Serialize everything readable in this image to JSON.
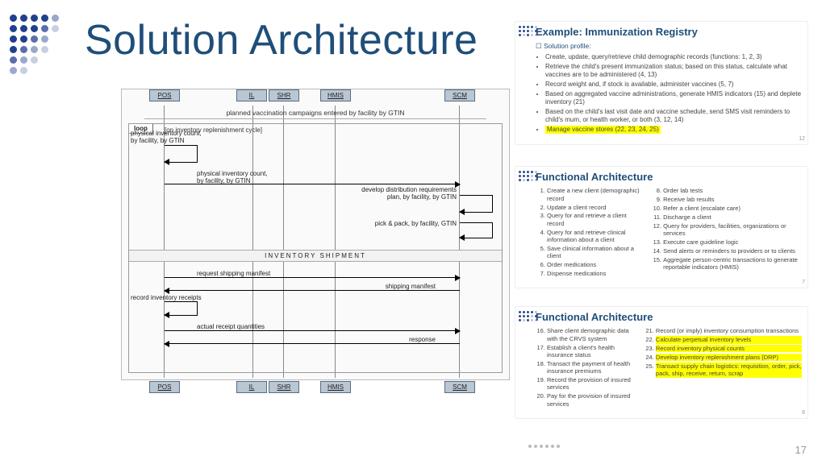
{
  "title": "Solution Architecture",
  "page_number": "17",
  "diagram": {
    "actors": [
      "POS",
      "IL",
      "SHR",
      "HMIS",
      "SCM"
    ],
    "caption": "planned vaccination campaigns entered by facility by GTIN",
    "loop_label": "loop",
    "loop_guard": "[on inventory replenishment cycle]",
    "self_msgs": {
      "pos_count": "physical inventory count,\nby facility, by GTIN",
      "scm_plan": "develop distribution requirements\nplan, by facility, by GTIN",
      "scm_pick": "pick & pack, by facility, GTIN"
    },
    "msgs": {
      "count_fwd": "physical inventory count,\nby facility, by GTIN",
      "req_manifest": "request shipping manifest",
      "ship_manifest": "shipping manifest",
      "record_receipts": "record inventory receipts",
      "actual_qty": "actual receipt quantities",
      "response": "response"
    },
    "block": "INVENTORY SHIPMENT"
  },
  "thumbs": {
    "imm": {
      "title": "Example: Immunization Registry",
      "subtitle": "Solution profile:",
      "bullets": [
        "Create, update, query/retrieve child demographic records (functions: 1, 2, 3)",
        "Retrieve the child's present immunization status; based on this status, calculate what vaccines are to be administered (4, 13)",
        "Record weight and, if stock is available, administer vaccines (5, 7)",
        "Based on aggregated vaccine administrations, generate HMIS indicators (15) and deplete inventory (21)",
        "Based on the child's last visit date and vaccine schedule, send SMS visit reminders to child's mum, or health worker, or both (3, 12, 14)"
      ],
      "highlight": "Manage vaccine stores (22, 23, 24, 25)",
      "pg": "12"
    },
    "fa1": {
      "title": "Functional Architecture",
      "left": [
        "Create a new client (demographic) record",
        "Update a client record",
        "Query for and retrieve a client record",
        "Query for and retrieve clinical information about a client",
        "Save clinical information about a client",
        "Order medications",
        "Dispense medications"
      ],
      "right": [
        "Order lab tests",
        "Receive lab results",
        "Refer a client (escalate care)",
        "Discharge a client",
        "Query for providers, facilities, organizations or services",
        "Execute care guideline logic",
        "Send alerts or reminders to providers or to clients",
        "Aggregate person-centric transactions to generate reportable indicators (HMIS)"
      ],
      "pg": "7"
    },
    "fa2": {
      "title": "Functional Architecture",
      "left": [
        "Share client demographic data with the CRVS system",
        "Establish a client's health insurance status",
        "Transact the payment of health insurance premiums",
        "Record the provision of insured services",
        "Pay for the provision of insured services"
      ],
      "right_plain": "Record (or imply) inventory consumption transactions",
      "right_hi": [
        "Calculate perpetual inventory levels",
        "Record inventory physical counts",
        "Develop inventory replenishment plans (DRP)",
        "Transact supply chain logistics: requisition, order, pick, pack, ship, receive, return, scrap"
      ],
      "pg": "8"
    }
  }
}
